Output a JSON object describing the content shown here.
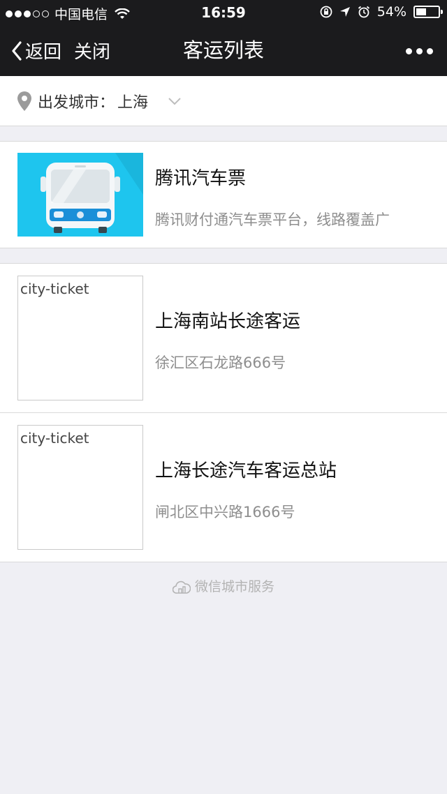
{
  "status": {
    "carrier": "中国电信",
    "time": "16:59",
    "battery": "54%",
    "battery_level": 0.54
  },
  "nav": {
    "back_label": "返回",
    "close_label": "关闭",
    "title": "客运列表"
  },
  "city": {
    "label": "出发城市：",
    "value": "上海"
  },
  "items": [
    {
      "title": "腾讯汽车票",
      "subtitle": "腾讯财付通汽车票平台，线路覆盖广",
      "image": "bus-image"
    },
    {
      "title": "上海南站长途客运",
      "subtitle": "徐汇区石龙路666号",
      "image_alt": "city-ticket"
    },
    {
      "title": "上海长途汽车客运总站",
      "subtitle": "闸北区中兴路1666号",
      "image_alt": "city-ticket"
    }
  ],
  "footer": {
    "text": "微信城市服务"
  }
}
